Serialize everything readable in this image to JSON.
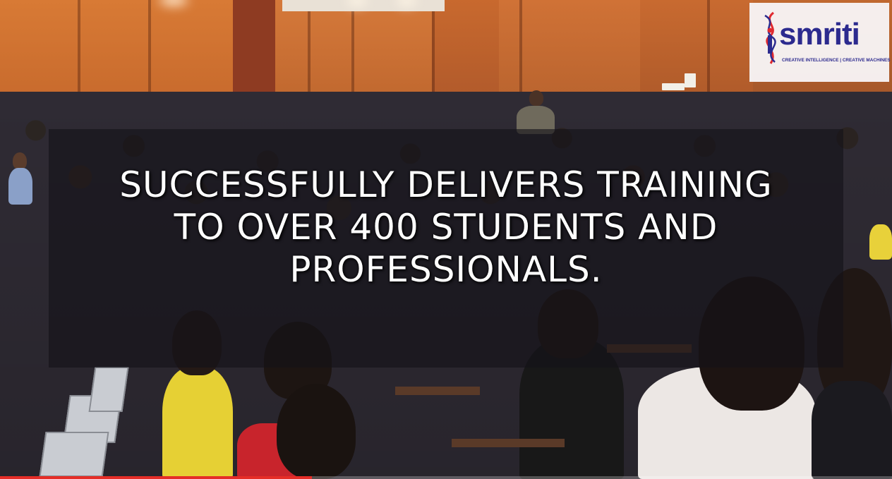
{
  "video": {
    "headline_lines": [
      "Successfully delivers training",
      "to over 400 students and",
      "professionals."
    ],
    "progress_fraction": 0.35
  },
  "logo": {
    "wordmark": "smriti",
    "tagline": "CREATIVE INTELLIGENCE | CREATIVE MACHINES",
    "colors": {
      "primary": "#2c2a8e",
      "accent": "#e0292f"
    }
  },
  "colors": {
    "progress": "#e52d27"
  }
}
